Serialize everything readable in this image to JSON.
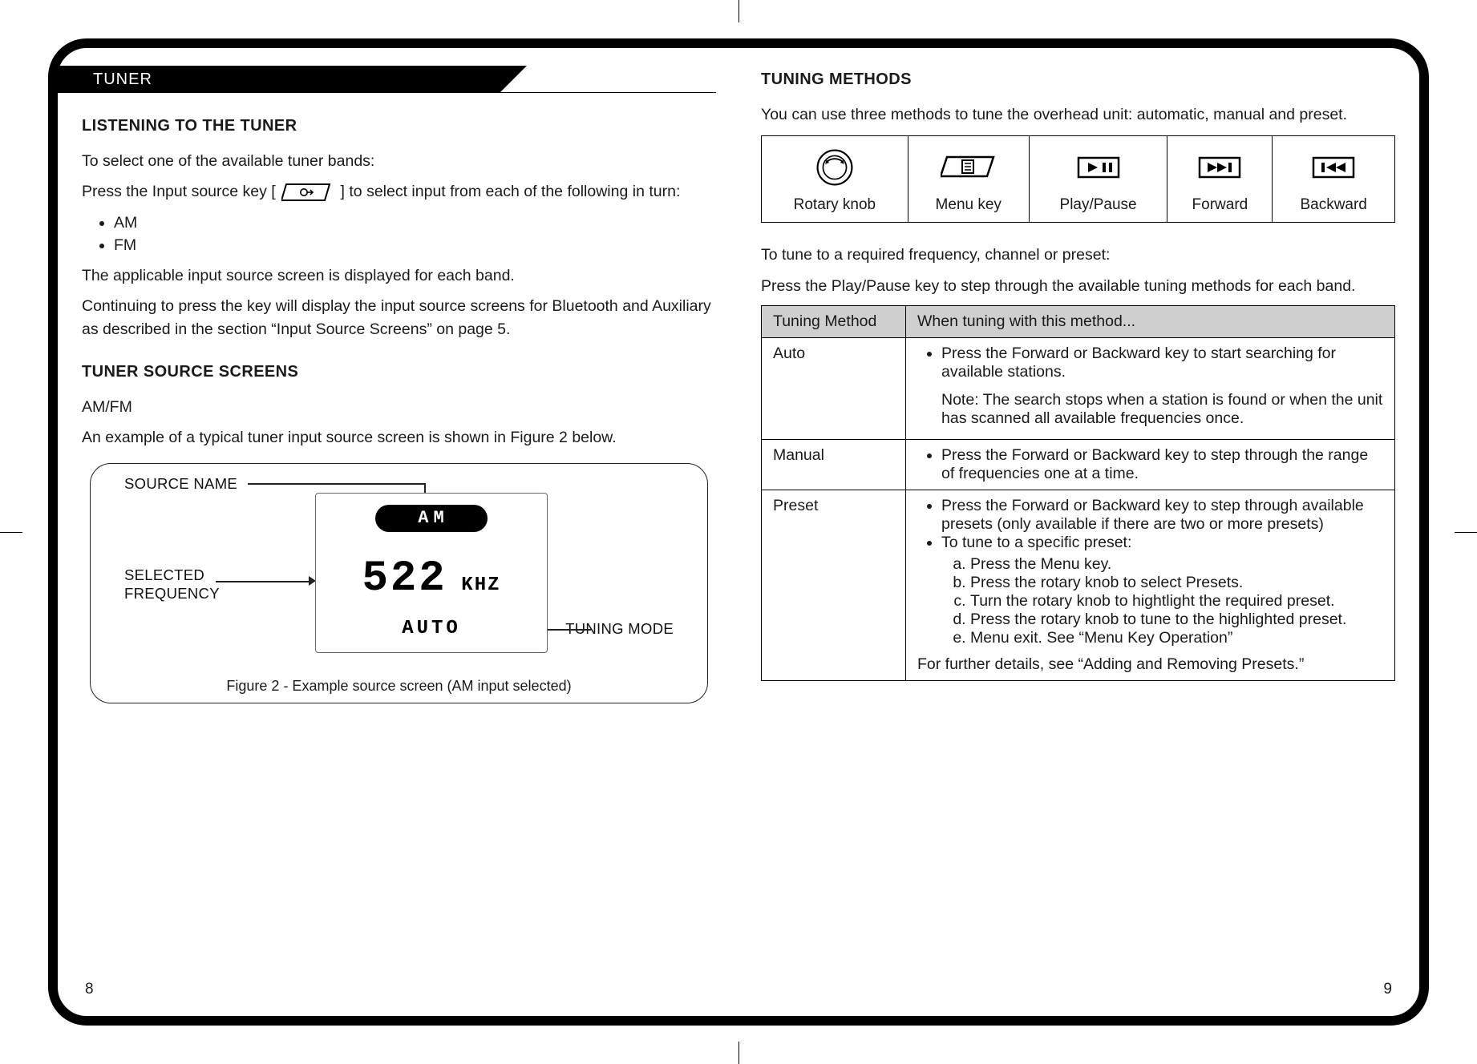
{
  "page_numbers": {
    "left": "8",
    "right": "9"
  },
  "section_tab": "TUNER",
  "left": {
    "h1": "LISTENING TO THE TUNER",
    "intro": "To select one of the available tuner bands:",
    "press_pre": "Press the Input source key [",
    "press_post": "] to select input from each of the following in turn:",
    "bands": [
      "AM",
      "FM"
    ],
    "line_a": "The applicable input source screen is displayed for each band.",
    "line_b": "Continuing to press the key will display the input source screens for Bluetooth and Auxiliary as described in the section “Input Source Screens” on page 5.",
    "h2": "TUNER SOURCE SCREENS",
    "h2_sub": "AM/FM",
    "h2_intro": "An example of a typical tuner input source screen is shown in Figure 2 below.",
    "fig_labels": {
      "source": "SOURCE NAME",
      "freq": "SELECTED\nFREQUENCY",
      "mode": "TUNING MODE"
    },
    "lcd": {
      "band": "AM",
      "freq": "522",
      "unit": "KHZ",
      "mode": "AUTO"
    },
    "fig_caption": "Figure 2 - Example source screen (AM input selected)"
  },
  "right": {
    "h1": "TUNING METHODS",
    "intro": "You can use three methods to tune the overhead unit: automatic, manual and preset.",
    "controls": [
      {
        "label": "Rotary knob"
      },
      {
        "label": "Menu key"
      },
      {
        "label": "Play/Pause"
      },
      {
        "label": "Forward"
      },
      {
        "label": "Backward"
      }
    ],
    "tune_a": "To tune to a required frequency, channel or preset:",
    "tune_b": "Press the Play/Pause key to step through the available tuning methods for each band.",
    "method_headers": [
      "Tuning Method",
      "When tuning with this method..."
    ],
    "methods": {
      "auto": {
        "name": "Auto",
        "bullet": "Press the Forward or Backward key to start searching for available stations.",
        "note": "Note: The search stops when a station is found or when the unit has scanned all available frequencies once."
      },
      "manual": {
        "name": "Manual",
        "bullet": "Press the Forward or Backward key to step through the range of frequencies one at a time."
      },
      "preset": {
        "name": "Preset",
        "bullet1": "Press the Forward or Backward key to step through available presets (only available if there are two or more presets)",
        "bullet2_lead": "To tune to a specific preset:",
        "steps": [
          "Press the Menu key.",
          "Press the rotary knob to select Presets.",
          "Turn the rotary knob to hightlight the required preset.",
          "Press the rotary knob to tune to the highlighted preset.",
          "Menu exit.  See “Menu Key Operation”"
        ],
        "footer": "For further details, see “Adding and Removing Presets.”"
      }
    }
  }
}
